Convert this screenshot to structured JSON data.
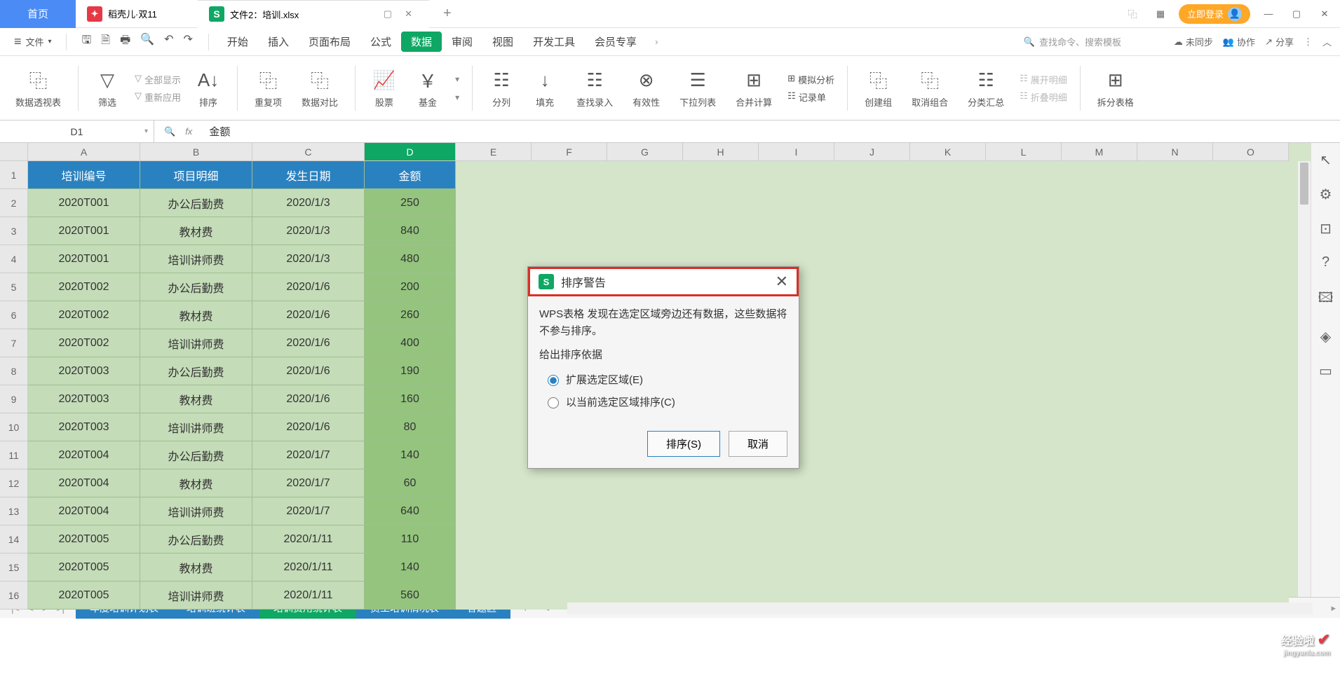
{
  "titlebar": {
    "home": "首页",
    "docer": "稻壳儿·双11",
    "file_tab": "文件2：培训.xlsx",
    "login": "立即登录"
  },
  "menu": {
    "file": "文件",
    "items": [
      "开始",
      "插入",
      "页面布局",
      "公式",
      "数据",
      "审阅",
      "视图",
      "开发工具",
      "会员专享"
    ],
    "active_index": 4,
    "search_placeholder": "查找命令、搜索模板",
    "unsync": "未同步",
    "coop": "协作",
    "share": "分享"
  },
  "ribbon": {
    "pivot": "数据透视表",
    "filter": "筛选",
    "show_all": "全部显示",
    "reapply": "重新应用",
    "sort": "排序",
    "dup": "重复项",
    "compare": "数据对比",
    "stock": "股票",
    "fund": "基金",
    "split": "分列",
    "fill": "填充",
    "find_input": "查找录入",
    "validity": "有效性",
    "dropdown": "下拉列表",
    "consolidate": "合并计算",
    "simulate": "模拟分析",
    "record": "记录单",
    "group": "创建组",
    "ungroup": "取消组合",
    "subtotal": "分类汇总",
    "expand": "展开明细",
    "collapse": "折叠明细",
    "split_sheet": "拆分表格"
  },
  "formula": {
    "cell_ref": "D1",
    "value": "金额"
  },
  "grid": {
    "cols_data": [
      "A",
      "B",
      "C",
      "D"
    ],
    "cols_empty": [
      "E",
      "F",
      "G",
      "H",
      "I",
      "J",
      "K",
      "L",
      "M",
      "N",
      "O"
    ],
    "header": [
      "培训编号",
      "项目明细",
      "发生日期",
      "金额"
    ],
    "col_widths": {
      "A": 160,
      "B": 160,
      "C": 160,
      "D": 130,
      "empty": 108
    },
    "rows": [
      [
        "2020T001",
        "办公后勤费",
        "2020/1/3",
        "250"
      ],
      [
        "2020T001",
        "教材费",
        "2020/1/3",
        "840"
      ],
      [
        "2020T001",
        "培训讲师费",
        "2020/1/3",
        "480"
      ],
      [
        "2020T002",
        "办公后勤费",
        "2020/1/6",
        "200"
      ],
      [
        "2020T002",
        "教材费",
        "2020/1/6",
        "260"
      ],
      [
        "2020T002",
        "培训讲师费",
        "2020/1/6",
        "400"
      ],
      [
        "2020T003",
        "办公后勤费",
        "2020/1/6",
        "190"
      ],
      [
        "2020T003",
        "教材费",
        "2020/1/6",
        "160"
      ],
      [
        "2020T003",
        "培训讲师费",
        "2020/1/6",
        "80"
      ],
      [
        "2020T004",
        "办公后勤费",
        "2020/1/7",
        "140"
      ],
      [
        "2020T004",
        "教材费",
        "2020/1/7",
        "60"
      ],
      [
        "2020T004",
        "培训讲师费",
        "2020/1/7",
        "640"
      ],
      [
        "2020T005",
        "办公后勤费",
        "2020/1/11",
        "110"
      ],
      [
        "2020T005",
        "教材费",
        "2020/1/11",
        "140"
      ],
      [
        "2020T005",
        "培训讲师费",
        "2020/1/11",
        "560"
      ]
    ]
  },
  "sheets": {
    "tabs": [
      "年度培训计划表",
      "培训班统计表",
      "培训费用统计表",
      "员工培训情况表",
      "答题区"
    ],
    "active_index": 2
  },
  "dialog": {
    "title": "排序警告",
    "body": "WPS表格 发现在选定区域旁边还有数据，这些数据将不参与排序。",
    "section": "给出排序依据",
    "opt1": "扩展选定区域(E)",
    "opt2": "以当前选定区域排序(C)",
    "ok": "排序(S)",
    "cancel": "取消"
  },
  "watermark": "经验啦"
}
